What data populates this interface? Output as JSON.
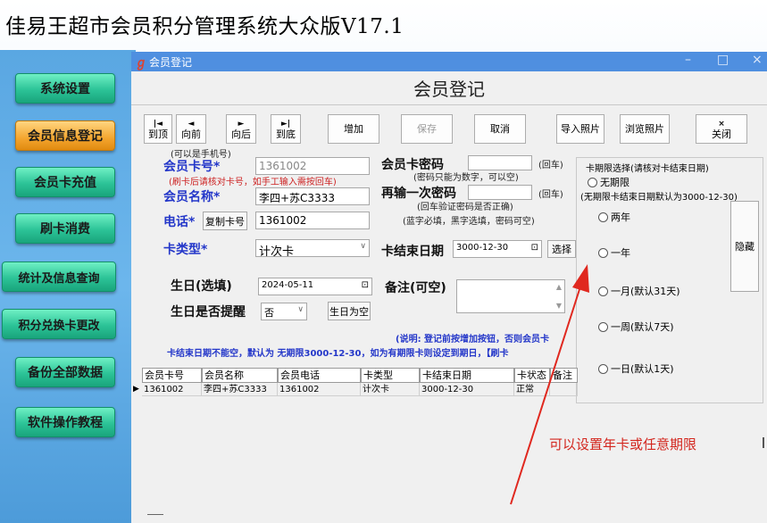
{
  "app": {
    "title": "佳易王超市会员积分管理系统大众版V17.1"
  },
  "nav": [
    {
      "label": "系统设置"
    },
    {
      "label": "会员信息登记"
    },
    {
      "label": "会员卡充值"
    },
    {
      "label": "刷卡消费"
    },
    {
      "label": "统计及信息查询"
    },
    {
      "label": "积分兑换卡更改"
    },
    {
      "label": "备份全部数据"
    },
    {
      "label": "软件操作教程"
    }
  ],
  "window": {
    "title": "会员登记",
    "heading": "会员登记"
  },
  "toolbar": {
    "first": {
      "icon": "|◄",
      "label": "到顶"
    },
    "prev": {
      "icon": "◄",
      "label": "向前"
    },
    "next": {
      "icon": "►",
      "label": "向后"
    },
    "last": {
      "icon": "►|",
      "label": "到底"
    },
    "add": "增加",
    "save": "保存",
    "cancel": "取消",
    "import_photo": "导入照片",
    "browse_photo": "浏览照片",
    "close_icon": "×",
    "close": "关闭"
  },
  "form": {
    "card_no_hint": "(可以是手机号)",
    "card_no_label": "会员卡号*",
    "card_no_value": "1361002",
    "card_no_note": "(刷卡后请核对卡号，如手工输入需按回车)",
    "name_label": "会员名称*",
    "name_value": "李四+苏C3333",
    "phone_label": "电话*",
    "copy_card_btn": "复制卡号",
    "phone_value": "1361002",
    "card_type_label": "卡类型*",
    "card_type_value": "计次卡",
    "birthday_label": "生日(选填)",
    "birthday_value": "2024-05-11",
    "birthday_remind_label": "生日是否提醒",
    "birthday_remind_value": "否",
    "birthday_clear_btn": "生日为空",
    "pwd_label": "会员卡密码",
    "pwd_enter": "(回车)",
    "pwd_note": "(密码只能为数字，可以空)",
    "pwd2_label": "再输一次密码",
    "pwd2_enter": "(回车)",
    "pwd2_note": "(回车验证密码是否正确)",
    "pwd_hint": "(蓝字必填，黑字选填，密码可空)",
    "end_date_label": "卡结束日期",
    "end_date_value": "3000-12-30",
    "select_btn": "选择",
    "remark_label": "备注(可空)",
    "explain_line1": "(说明: 登记前按增加按钮，否则会员卡",
    "explain_line2": "卡结束日期不能空，默认为 无期限3000-12-30，如为有期限卡则设定到期日，【刷卡"
  },
  "period": {
    "title": "卡期限选择(请核对卡结束日期)",
    "unlimited": "无期限",
    "unlimited_note": "(无期限卡结束日期默认为3000-12-30)",
    "two_year": "两年",
    "one_year": "一年",
    "one_month": "一月(默认31天)",
    "one_week": "一周(默认7天)",
    "one_day": "一日(默认1天)",
    "hide_btn": "隐藏"
  },
  "grid": {
    "columns": [
      "会员卡号",
      "会员名称",
      "会员电话",
      "卡类型",
      "卡结束日期",
      "卡状态",
      "备注"
    ],
    "rows": [
      [
        "1361002",
        "李四+苏C3333",
        "1361002",
        "计次卡",
        "3000-12-30",
        "正常",
        ""
      ]
    ]
  },
  "annotation": "可以设置年卡或任意期限",
  "colors": {
    "accent_blue": "#2437c9",
    "annotation_red": "#d3261e",
    "nav_green": "#2cc397",
    "nav_active": "#f4a52e"
  }
}
